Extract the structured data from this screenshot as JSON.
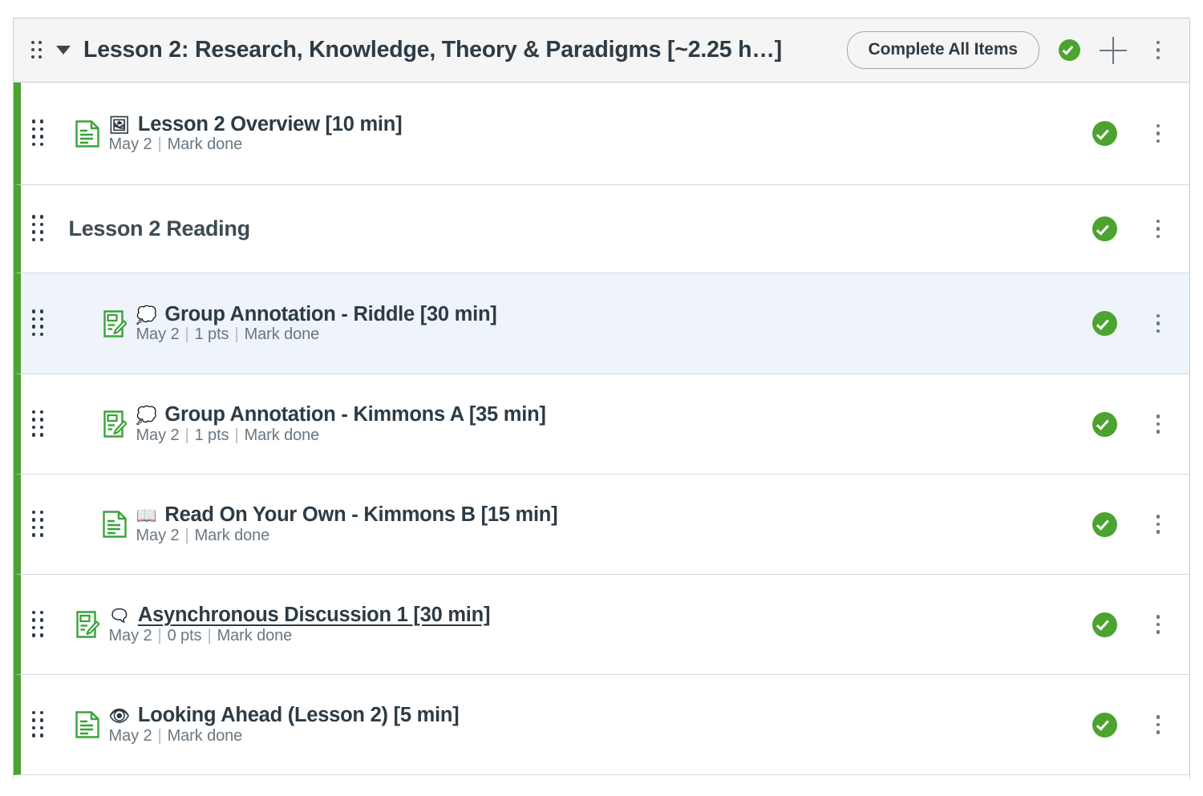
{
  "module": {
    "title": "Lesson 2: Research, Knowledge, Theory & Paradigms [~2.25 h…]",
    "complete_all_label": "Complete All Items",
    "drag_handle_name": "module-drag-handle",
    "published_status": "Published",
    "add_label": "Add item",
    "menu_label": "Module options",
    "accent_color": "#4ca32f",
    "header_background": "#f5f5f5"
  },
  "selected_row_background": "#eef4fa",
  "rows": [
    {
      "kind": "item",
      "icon": "document-icon",
      "emoji": "🖼",
      "emoji_name": "framed-picture-emoji",
      "title": "Lesson 2 Overview [10 min]",
      "meta": {
        "due": "May 2",
        "points": null,
        "completion": "Mark done"
      },
      "indent": 1,
      "selected": false,
      "hovered": false,
      "status": "Published"
    },
    {
      "kind": "header",
      "title": "Lesson 2 Reading",
      "indent": 0,
      "selected": false,
      "hovered": false,
      "status": "Published"
    },
    {
      "kind": "item",
      "icon": "assignment-icon",
      "emoji": "💭",
      "emoji_name": "thought-balloon-emoji",
      "title": "Group Annotation - Riddle [30 min]",
      "meta": {
        "due": "May 2",
        "points": "1 pts",
        "completion": "Mark done"
      },
      "indent": 2,
      "selected": true,
      "hovered": false,
      "status": "Published"
    },
    {
      "kind": "item",
      "icon": "assignment-icon",
      "emoji": "💭",
      "emoji_name": "thought-balloon-emoji",
      "title": "Group Annotation - Kimmons A [35 min]",
      "meta": {
        "due": "May 2",
        "points": "1 pts",
        "completion": "Mark done"
      },
      "indent": 2,
      "selected": false,
      "hovered": false,
      "status": "Published"
    },
    {
      "kind": "item",
      "icon": "document-icon",
      "emoji": "📖",
      "emoji_name": "open-book-emoji",
      "title": "Read On Your Own - Kimmons B [15 min]",
      "meta": {
        "due": "May 2",
        "points": null,
        "completion": "Mark done"
      },
      "indent": 2,
      "selected": false,
      "hovered": false,
      "status": "Published"
    },
    {
      "kind": "item",
      "icon": "assignment-icon",
      "emoji": "🗨",
      "emoji_name": "speech-balloon-emoji",
      "title": "Asynchronous Discussion 1 [30 min]",
      "meta": {
        "due": "May 2",
        "points": "0 pts",
        "completion": "Mark done"
      },
      "indent": 1,
      "selected": false,
      "hovered": true,
      "status": "Published"
    },
    {
      "kind": "item",
      "icon": "document-icon",
      "emoji": "👁",
      "emoji_name": "eye-emoji",
      "title": "Looking Ahead (Lesson 2) [5 min]",
      "meta": {
        "due": "May 2",
        "points": null,
        "completion": "Mark done"
      },
      "indent": 1,
      "selected": false,
      "hovered": false,
      "status": "Published"
    }
  ]
}
